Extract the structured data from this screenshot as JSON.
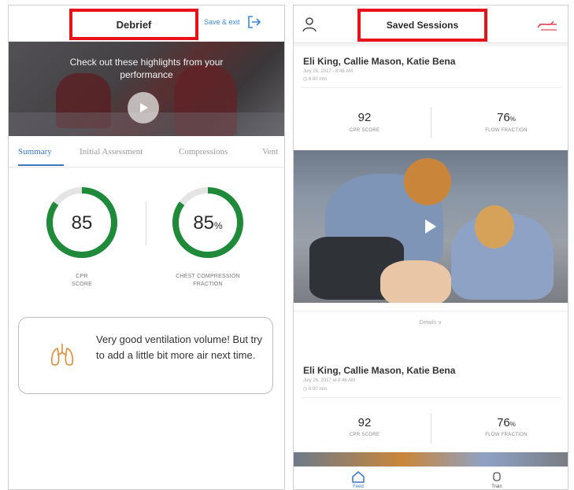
{
  "debrief": {
    "title": "Debrief",
    "save_exit": "Save & exit",
    "hero_text": "Check out these highlights from your performance",
    "tabs": [
      "Summary",
      "Initial Assessment",
      "Compressions",
      "Vent"
    ],
    "metrics": [
      {
        "value": "85",
        "suffix": "",
        "label_line1": "CPR",
        "label_line2": "SCORE",
        "progress": 0.85
      },
      {
        "value": "85",
        "suffix": "%",
        "label_line1": "CHEST COMPRESSION",
        "label_line2": "FRACTION",
        "progress": 0.85
      }
    ],
    "tip_text": "Very good ventilation volume! But try to add a little bit more air next time.",
    "ring_color": "#1f8a3a",
    "accent_color": "#3a78c4",
    "highlight_color": "#e8121b"
  },
  "sessions": {
    "title": "Saved Sessions",
    "cards": [
      {
        "names": "Eli King, Callie Mason, Katie Bena",
        "date": "July 26, 2017 · 8:46 AM",
        "duration": "6:00 min",
        "cpr_score": "92",
        "cpr_label": "CPR SCORE",
        "flow_value": "76",
        "flow_suffix": "%",
        "flow_label": "FLOW FRACTION",
        "details_label": "Details ∨"
      },
      {
        "names": "Eli King, Callie Mason, Katie Bena",
        "date": "July 26, 2017 at 8:46 AM",
        "duration": "6:00 min",
        "cpr_score": "92",
        "cpr_label": "CPR SCORE",
        "flow_value": "76",
        "flow_suffix": "%",
        "flow_label": "FLOW FRACTION"
      }
    ],
    "nav": [
      {
        "label": "Feed",
        "icon": "home-icon"
      },
      {
        "label": "Train",
        "icon": "train-icon"
      }
    ]
  }
}
